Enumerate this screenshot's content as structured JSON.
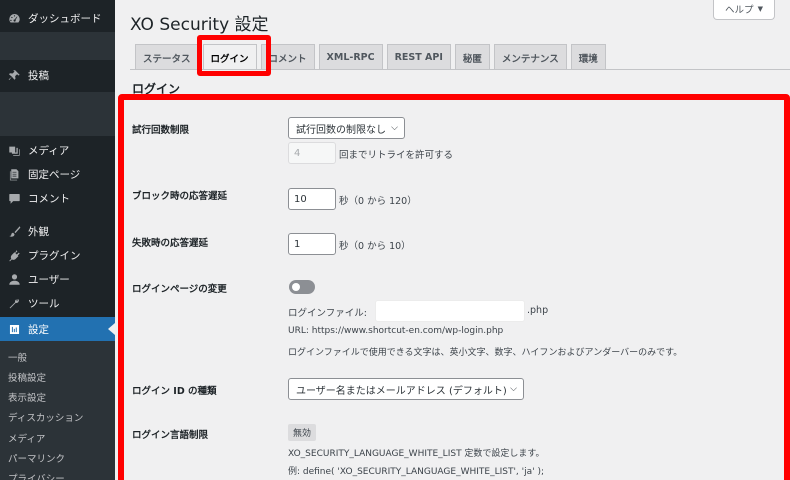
{
  "sidebar": {
    "dashboard": "ダッシュボード",
    "posts": "投稿",
    "media": "メディア",
    "pages": "固定ページ",
    "comments": "コメント",
    "appearance": "外観",
    "plugins": "プラグイン",
    "users": "ユーザー",
    "tools": "ツール",
    "settings": "設定",
    "submenu": [
      "一般",
      "投稿設定",
      "表示設定",
      "ディスカッション",
      "メディア",
      "パーマリンク",
      "プライバシー"
    ]
  },
  "header": {
    "title": "XO Security 設定",
    "help": "ヘルプ"
  },
  "tabs": [
    "ステータス",
    "ログイン",
    "コメント",
    "XML-RPC",
    "REST API",
    "秘匿",
    "メンテナンス",
    "環境"
  ],
  "section_title": "ログイン",
  "settings": {
    "attempt_limit": {
      "label": "試行回数制限",
      "select": "試行回数の制限なし",
      "retry_value": "4",
      "retry_text": "回までリトライを許可する"
    },
    "block_delay": {
      "label": "ブロック時の応答遅延",
      "value": "10",
      "unit": "秒（0 から 120）"
    },
    "fail_delay": {
      "label": "失敗時の応答遅延",
      "value": "1",
      "unit": "秒（0 から 10）"
    },
    "login_page": {
      "label": "ログインページの変更",
      "file_label": "ログインファイル:",
      "file_value": "",
      "ext": ".php",
      "url": "URL: https://www.shortcut-en.com/wp-login.php",
      "note": "ログインファイルで使用できる文字は、英小文字、数字、ハイフンおよびアンダーバーのみです。"
    },
    "login_id": {
      "label": "ログイン ID の種類",
      "select": "ユーザー名またはメールアドレス (デフォルト)"
    },
    "language": {
      "label": "ログイン言語制限",
      "badge": "無効",
      "text1": "XO_SECURITY_LANGUAGE_WHITE_LIST 定数で設定します。",
      "text2": "例: define( 'XO_SECURITY_LANGUAGE_WHITE_LIST', 'ja' );"
    }
  },
  "colors": {
    "highlight": "#ff0000",
    "admin_bar": "#1d2327",
    "accent": "#2271b1"
  },
  "icons": [
    "dashboard-icon",
    "pin-icon",
    "media-icon",
    "page-icon",
    "comment-icon",
    "brush-icon",
    "plugin-icon",
    "user-icon",
    "wrench-icon",
    "settings-icon"
  ]
}
